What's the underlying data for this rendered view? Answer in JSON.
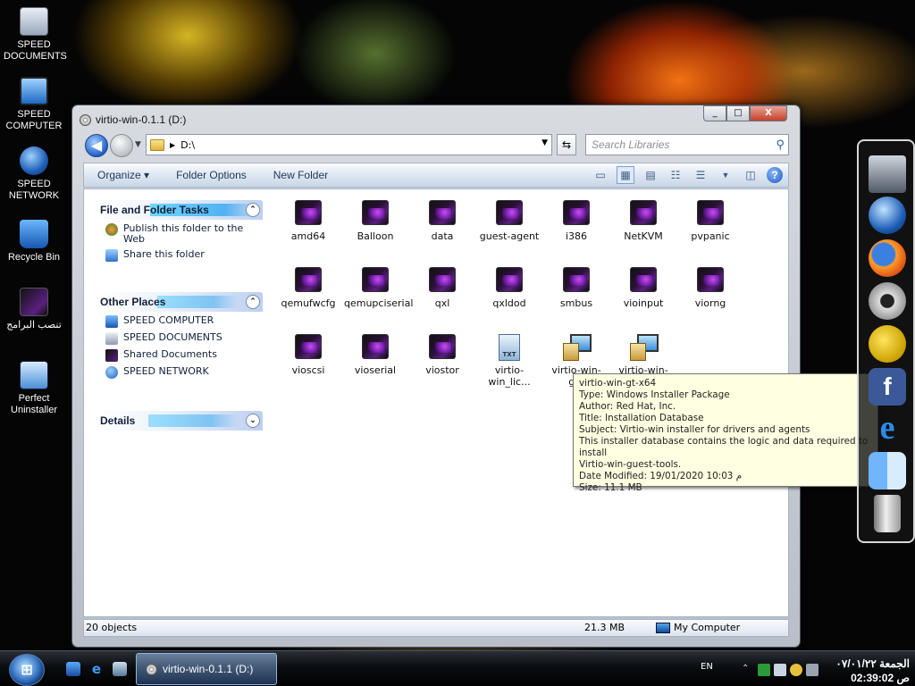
{
  "desktop": {
    "icons": [
      {
        "label": "SPEED DOCUMENTS"
      },
      {
        "label": "SPEED COMPUTER"
      },
      {
        "label": "SPEED NETWORK"
      },
      {
        "label": "Recycle Bin"
      },
      {
        "label": "تنصب البرامج"
      },
      {
        "label": "Perfect Uninstaller"
      }
    ]
  },
  "window": {
    "title": "virtio-win-0.1.1 (D:)",
    "buttons": {
      "minimize": "_",
      "maximize": "□",
      "close": "X"
    },
    "nav": {
      "back": "◀",
      "dropdown": "▼"
    },
    "address": {
      "path": "D:\\",
      "dropdown": "▼"
    },
    "refresh": "⇆",
    "search": {
      "placeholder": "Search Libraries"
    },
    "toolbar": {
      "organize": "Organize ▾",
      "folder_options": "Folder Options",
      "new_folder": "New Folder",
      "help": "?"
    },
    "tasks": {
      "file_folder": {
        "title": "File and Folder Tasks",
        "items": [
          {
            "label": "Publish this folder to the Web"
          },
          {
            "label": "Share this folder"
          }
        ]
      },
      "other_places": {
        "title": "Other Places",
        "items": [
          {
            "label": "SPEED COMPUTER"
          },
          {
            "label": "SPEED DOCUMENTS"
          },
          {
            "label": "Shared Documents"
          },
          {
            "label": "SPEED NETWORK"
          }
        ]
      },
      "details": {
        "title": "Details"
      }
    },
    "files": [
      {
        "name": "amd64",
        "type": "folder"
      },
      {
        "name": "Balloon",
        "type": "folder"
      },
      {
        "name": "data",
        "type": "folder"
      },
      {
        "name": "guest-agent",
        "type": "folder"
      },
      {
        "name": "i386",
        "type": "folder"
      },
      {
        "name": "NetKVM",
        "type": "folder"
      },
      {
        "name": "pvpanic",
        "type": "folder"
      },
      {
        "name": "qemufwcfg",
        "type": "folder"
      },
      {
        "name": "qemupciserial",
        "type": "folder"
      },
      {
        "name": "qxl",
        "type": "folder"
      },
      {
        "name": "qxldod",
        "type": "folder"
      },
      {
        "name": "smbus",
        "type": "folder"
      },
      {
        "name": "vioinput",
        "type": "folder"
      },
      {
        "name": "viorng",
        "type": "folder"
      },
      {
        "name": "vioscsi",
        "type": "folder"
      },
      {
        "name": "vioserial",
        "type": "folder"
      },
      {
        "name": "viostor",
        "type": "folder"
      },
      {
        "name": "virtio-win_lic...",
        "type": "text",
        "badge": "TXT"
      },
      {
        "name": "virtio-win-g...",
        "type": "installer"
      },
      {
        "name": "virtio-win-g...",
        "type": "installer"
      }
    ],
    "status": {
      "count": "20 objects",
      "size": "21.3 MB",
      "location": "My Computer"
    }
  },
  "tooltip": {
    "lines": [
      "virtio-win-gt-x64",
      "Type: Windows Installer Package",
      "Author: Red Hat, Inc.",
      "Title: Installation Database",
      "Subject: Virtio-win installer for drivers and agents",
      "This installer database contains the logic and data required to install",
      "Virtio-win-guest-tools.",
      "Date Modified: 19/01/2020 10:03 م",
      "Size: 11.1 MB"
    ]
  },
  "taskbar": {
    "task_label": "virtio-win-0.1.1 (D:)",
    "language": "EN",
    "clock": {
      "date": "الجمعة ٠٧/٠١/٢٢",
      "time": "02:39:02 ص"
    }
  }
}
